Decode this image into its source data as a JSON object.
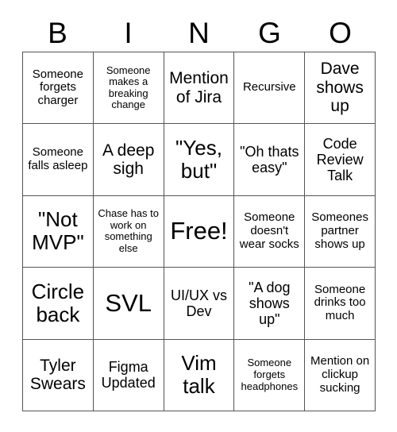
{
  "card": {
    "title": "BINGO",
    "background_color": "#ffffff",
    "text_color": "#000000",
    "border_color": "#555555",
    "header_letters": [
      "B",
      "I",
      "N",
      "G",
      "O"
    ],
    "columns": 5,
    "rows": 5,
    "free_space_label": "Free!",
    "cells": [
      {
        "text": "Someone forgets charger",
        "size": "fs-sm",
        "name": "bingo-cell-b1"
      },
      {
        "text": "Someone makes a breaking change",
        "size": "fs-xs",
        "name": "bingo-cell-i1"
      },
      {
        "text": "Mention of Jira",
        "size": "fs-lg",
        "name": "bingo-cell-n1"
      },
      {
        "text": "Recursive",
        "size": "fs-sm",
        "name": "bingo-cell-g1"
      },
      {
        "text": "Dave shows up",
        "size": "fs-lg",
        "name": "bingo-cell-o1"
      },
      {
        "text": "Someone falls asleep",
        "size": "fs-sm",
        "name": "bingo-cell-b2"
      },
      {
        "text": "A deep sigh",
        "size": "fs-lg",
        "name": "bingo-cell-i2"
      },
      {
        "text": "\"Yes, but\"",
        "size": "fs-xl",
        "name": "bingo-cell-n2"
      },
      {
        "text": "\"Oh thats easy\"",
        "size": "fs-md",
        "name": "bingo-cell-g2"
      },
      {
        "text": "Code Review Talk",
        "size": "fs-md",
        "name": "bingo-cell-o2"
      },
      {
        "text": "\"Not MVP\"",
        "size": "fs-xl",
        "name": "bingo-cell-b3"
      },
      {
        "text": "Chase has to work on something else",
        "size": "fs-xs",
        "name": "bingo-cell-i3"
      },
      {
        "text": "Free!",
        "size": "fs-xxl",
        "name": "bingo-cell-free"
      },
      {
        "text": "Someone doesn't wear socks",
        "size": "fs-sm",
        "name": "bingo-cell-g3"
      },
      {
        "text": "Someones partner shows up",
        "size": "fs-sm",
        "name": "bingo-cell-o3"
      },
      {
        "text": "Circle back",
        "size": "fs-xl",
        "name": "bingo-cell-b4"
      },
      {
        "text": "SVL",
        "size": "fs-xxl",
        "name": "bingo-cell-i4"
      },
      {
        "text": "UI/UX vs Dev",
        "size": "fs-md",
        "name": "bingo-cell-n4"
      },
      {
        "text": "\"A dog shows up\"",
        "size": "fs-md",
        "name": "bingo-cell-g4"
      },
      {
        "text": "Someone drinks too much",
        "size": "fs-sm",
        "name": "bingo-cell-o4"
      },
      {
        "text": "Tyler Swears",
        "size": "fs-lg",
        "name": "bingo-cell-b5"
      },
      {
        "text": "Figma Updated",
        "size": "fs-md",
        "name": "bingo-cell-i5"
      },
      {
        "text": "Vim talk",
        "size": "fs-xl",
        "name": "bingo-cell-n5"
      },
      {
        "text": "Someone forgets headphones",
        "size": "fs-xs",
        "name": "bingo-cell-g5"
      },
      {
        "text": "Mention on clickup sucking",
        "size": "fs-sm",
        "name": "bingo-cell-o5"
      }
    ]
  }
}
